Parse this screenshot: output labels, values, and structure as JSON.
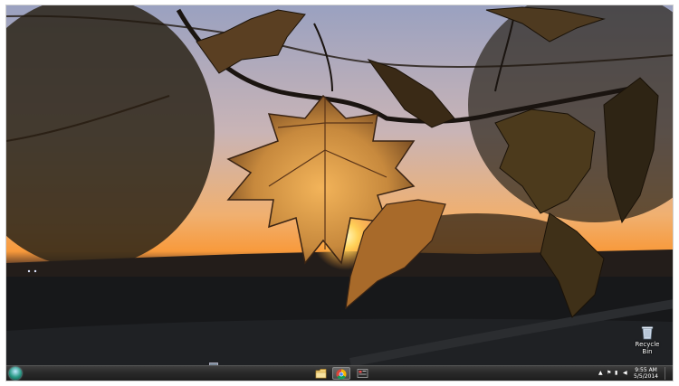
{
  "desktop": {
    "recycle_bin_label": "Recycle Bin"
  },
  "taskbar": {
    "start_icon": "windows-orb-icon",
    "pinned": [
      {
        "name": "file-explorer-icon",
        "active": false
      },
      {
        "name": "chrome-icon",
        "active": true
      },
      {
        "name": "control-panel-icon",
        "active": false
      }
    ],
    "tray": {
      "clock_time": "9:55 AM",
      "clock_date": "5/5/2014",
      "icons": [
        "show-hidden-icons",
        "flag-icon",
        "network-icon",
        "volume-icon"
      ]
    }
  },
  "colors": {
    "taskbar": "#2b2b2b",
    "sky_top": "#b9c0d8",
    "sunset": "#f7a341",
    "leaf": "#c98a3a"
  }
}
